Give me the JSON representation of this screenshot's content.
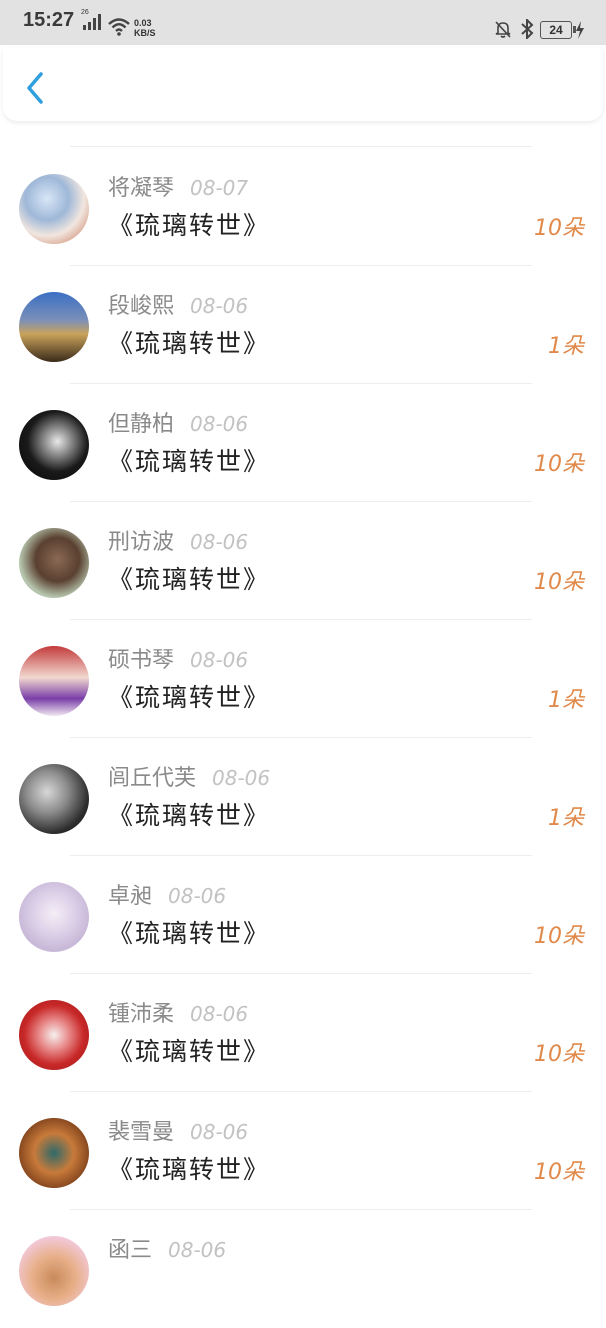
{
  "status_bar": {
    "time": "15:27",
    "network": "26",
    "speed_value": "0.03",
    "speed_unit": "KB/S",
    "battery": "24"
  },
  "nav": {
    "back_icon": "chevron-left-icon"
  },
  "colors": {
    "accent": "#2f9fe0",
    "count": "#e0894a",
    "date": "#c2c2c2"
  },
  "list": [
    {
      "name": "将凝琴",
      "date": "08-07",
      "gift": "《琉璃转世》",
      "count": "10朵"
    },
    {
      "name": "段峻熙",
      "date": "08-06",
      "gift": "《琉璃转世》",
      "count": "1朵"
    },
    {
      "name": "但静柏",
      "date": "08-06",
      "gift": "《琉璃转世》",
      "count": "10朵"
    },
    {
      "name": "刑访波",
      "date": "08-06",
      "gift": "《琉璃转世》",
      "count": "10朵"
    },
    {
      "name": "硕书琴",
      "date": "08-06",
      "gift": "《琉璃转世》",
      "count": "1朵"
    },
    {
      "name": "闾丘代芙",
      "date": "08-06",
      "gift": "《琉璃转世》",
      "count": "1朵"
    },
    {
      "name": "卓昶",
      "date": "08-06",
      "gift": "《琉璃转世》",
      "count": "10朵"
    },
    {
      "name": "锺沛柔",
      "date": "08-06",
      "gift": "《琉璃转世》",
      "count": "10朵"
    },
    {
      "name": "裴雪曼",
      "date": "08-06",
      "gift": "《琉璃转世》",
      "count": "10朵"
    },
    {
      "name": "函三",
      "date": "08-06",
      "gift": "",
      "count": ""
    }
  ]
}
